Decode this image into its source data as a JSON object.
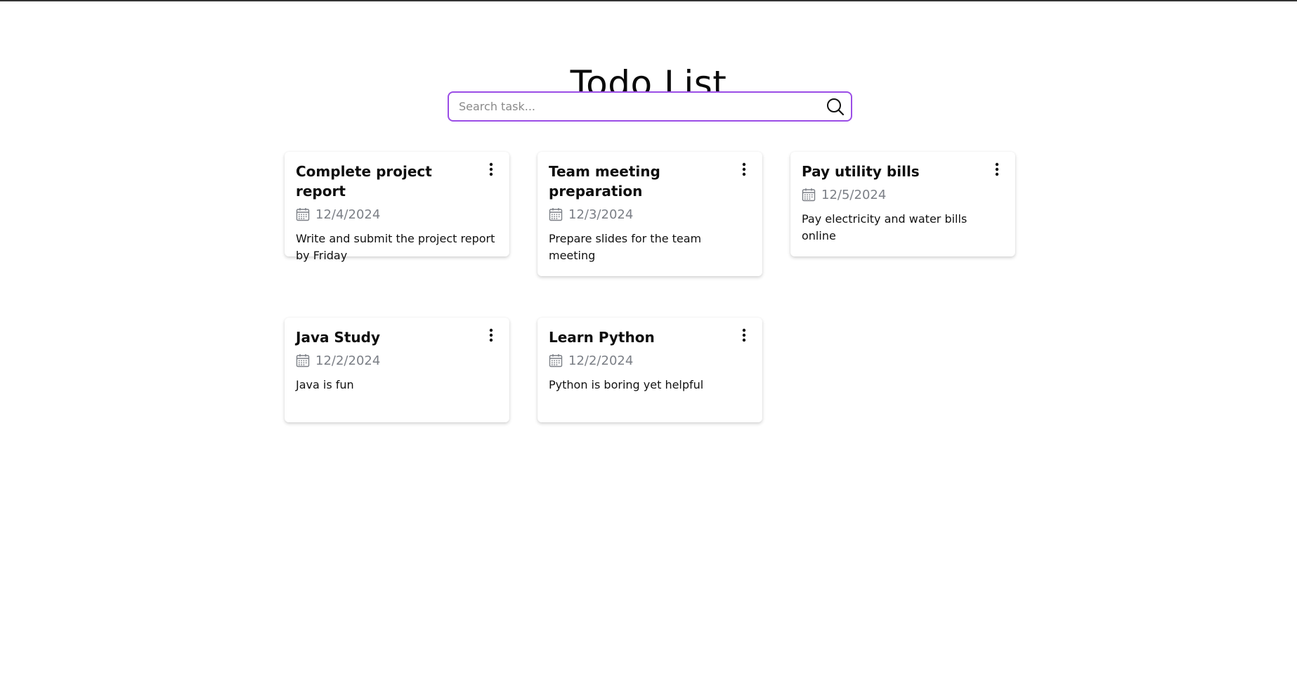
{
  "page": {
    "title": "Todo List"
  },
  "search": {
    "placeholder": "Search task...",
    "value": "",
    "icon": "search-icon",
    "border_color": "#9b4de6"
  },
  "tasks": [
    {
      "title": "Complete project report",
      "date": "12/4/2024",
      "description": "Write and submit the project report by Friday"
    },
    {
      "title": "Team meeting preparation",
      "date": "12/3/2024",
      "description": "Prepare slides for the team meeting"
    },
    {
      "title": "Pay utility bills",
      "date": "12/5/2024",
      "description": "Pay electricity and water bills online"
    },
    {
      "title": "Java Study",
      "date": "12/2/2024",
      "description": "Java is fun"
    },
    {
      "title": "Learn Python",
      "date": "12/2/2024",
      "description": "Python is boring yet helpful"
    }
  ],
  "icons": {
    "menu": "more-vertical-icon",
    "date": "calendar-icon"
  }
}
